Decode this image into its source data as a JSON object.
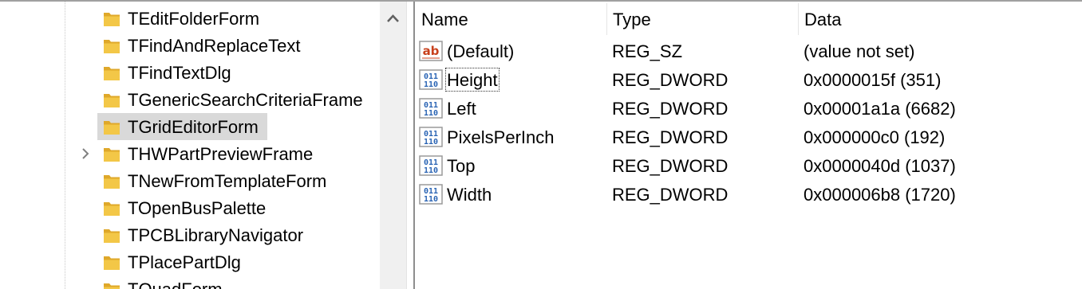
{
  "tree": {
    "items": [
      {
        "label": "TEditFolderForm",
        "expandable": false,
        "selected": false
      },
      {
        "label": "TFindAndReplaceText",
        "expandable": false,
        "selected": false
      },
      {
        "label": "TFindTextDlg",
        "expandable": false,
        "selected": false
      },
      {
        "label": "TGenericSearchCriteriaFrame",
        "expandable": false,
        "selected": false
      },
      {
        "label": "TGridEditorForm",
        "expandable": false,
        "selected": true
      },
      {
        "label": "THWPartPreviewFrame",
        "expandable": true,
        "selected": false
      },
      {
        "label": "TNewFromTemplateForm",
        "expandable": false,
        "selected": false
      },
      {
        "label": "TOpenBusPalette",
        "expandable": false,
        "selected": false
      },
      {
        "label": "TPCBLibraryNavigator",
        "expandable": false,
        "selected": false
      },
      {
        "label": "TPlacePartDlg",
        "expandable": false,
        "selected": false
      },
      {
        "label": "TQuadForm",
        "expandable": false,
        "selected": false
      }
    ]
  },
  "list": {
    "columns": {
      "name": "Name",
      "type": "Type",
      "data": "Data"
    },
    "rows": [
      {
        "name": "(Default)",
        "type": "REG_SZ",
        "data": "(value not set)",
        "icon": "string-value-icon"
      },
      {
        "name": "Height",
        "type": "REG_DWORD",
        "data": "0x0000015f (351)",
        "icon": "binary-value-icon"
      },
      {
        "name": "Left",
        "type": "REG_DWORD",
        "data": "0x00001a1a (6682)",
        "icon": "binary-value-icon"
      },
      {
        "name": "PixelsPerInch",
        "type": "REG_DWORD",
        "data": "0x000000c0 (192)",
        "icon": "binary-value-icon"
      },
      {
        "name": "Top",
        "type": "REG_DWORD",
        "data": "0x0000040d (1037)",
        "icon": "binary-value-icon"
      },
      {
        "name": "Width",
        "type": "REG_DWORD",
        "data": "0x000006b8 (1720)",
        "icon": "binary-value-icon"
      }
    ]
  },
  "colors": {
    "folder": "#f3c747",
    "folder_dark": "#dfa82a",
    "selection": "#d9d9d9",
    "string_icon": "#c8401c",
    "binary_icon": "#2a64b4"
  }
}
